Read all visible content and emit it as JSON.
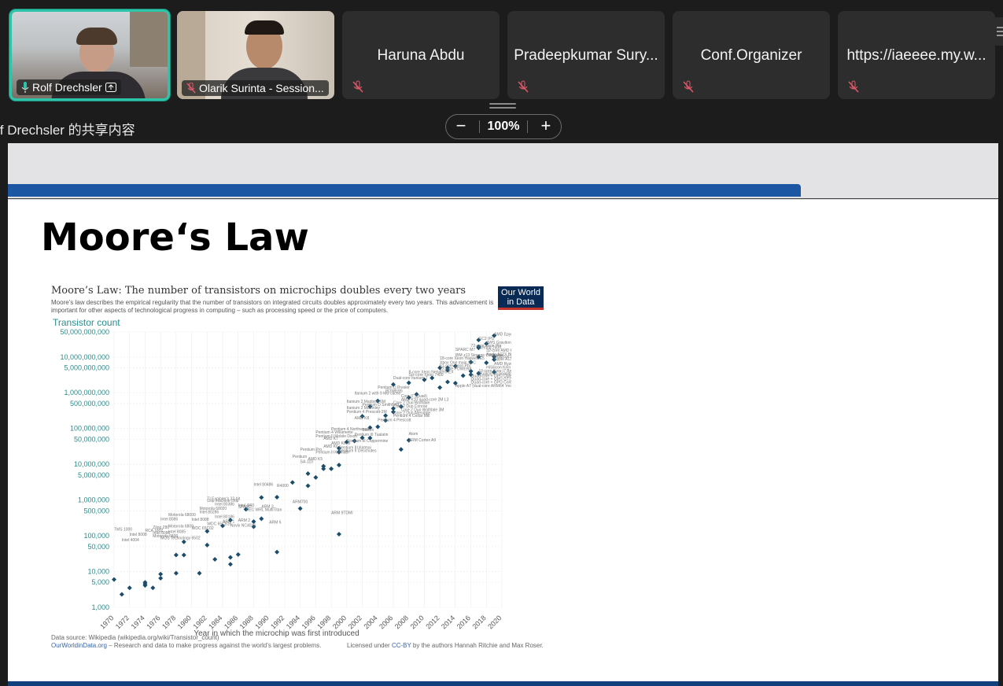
{
  "participants": [
    {
      "name": "Rolf Drechsler",
      "video": true,
      "active": true,
      "mic": "on",
      "presenting": true
    },
    {
      "name": "Olarik Surinta - Session...",
      "video": true,
      "active": false,
      "mic": "muted"
    },
    {
      "name": "Haruna Abdu",
      "video": false,
      "mic": "muted"
    },
    {
      "name": "Pradeepkumar Sury...",
      "video": false,
      "mic": "muted"
    },
    {
      "name": "Conf.Organizer",
      "video": false,
      "mic": "muted"
    },
    {
      "name": "https://iaeeee.my.w...",
      "video": false,
      "mic": "muted"
    }
  ],
  "share": {
    "label": "lf Drechsler 的共享内容",
    "zoom": "100%",
    "zoom_out": "−",
    "zoom_in": "+"
  },
  "slide": {
    "title": "Moore‘s Law"
  },
  "chart_data": {
    "type": "scatter",
    "title": "Moore’s Law: The number of transistors on microchips doubles every two years",
    "subtitle": "Moore’s law describes the empirical regularity that the number of transistors on integrated circuits doubles approximately every two years. This advancement is important for other aspects of technological progress in computing – such as processing speed or the price of computers.",
    "ylabel": "Transistor count",
    "xlabel": "Year in which the microchip was first introduced",
    "yscale": "log",
    "ylim": [
      1000,
      50000000000
    ],
    "xlim": [
      1970,
      2020
    ],
    "yticks": [
      "50,000,000,000",
      "10,000,000,000",
      "5,000,000,000",
      "1,000,000,000",
      "500,000,000",
      "100,000,000",
      "50,000,000",
      "10,000,000",
      "5,000,000",
      "1,000,000",
      "500,000",
      "100,000",
      "50,000",
      "10,000",
      "5,000",
      "1,000"
    ],
    "ytick_values": [
      50000000000,
      10000000000,
      5000000000,
      1000000000,
      500000000,
      100000000,
      50000000,
      10000000,
      5000000,
      1000000,
      500000,
      100000,
      50000,
      10000,
      5000,
      1000
    ],
    "xticks": [
      "1970",
      "1972",
      "1974",
      "1976",
      "1978",
      "1980",
      "1982",
      "1984",
      "1986",
      "1988",
      "1990",
      "1992",
      "1994",
      "1996",
      "1998",
      "2000",
      "2002",
      "2004",
      "2006",
      "2008",
      "2010",
      "2012",
      "2014",
      "2016",
      "2018",
      "2020"
    ],
    "source": "Data source: Wikipedia (wikipedia.org/wiki/Transistor_count)",
    "site": "OurWorldinData.org",
    "site_tail": " – Research and data to make progress against the world’s largest problems.",
    "license_pre": "Licensed under ",
    "license_link": "CC-BY",
    "license_post": " by the authors Hannah Ritchie and Max Roser.",
    "logo_line1": "Our World",
    "logo_line2": "in Data",
    "points": [
      {
        "x": 1971,
        "y": 2300,
        "label": "Intel 4004"
      },
      {
        "x": 1972,
        "y": 3500,
        "label": "Intel 8008"
      },
      {
        "x": 1970,
        "y": 6000,
        "label": "TMS 1000"
      },
      {
        "x": 1974,
        "y": 4500,
        "label": "Intel 8080"
      },
      {
        "x": 1974,
        "y": 5000,
        "label": "RCA 1802"
      },
      {
        "x": 1975,
        "y": 3510,
        "label": "MOS Technology 6502"
      },
      {
        "x": 1974,
        "y": 4100,
        "label": "Motorola 6800"
      },
      {
        "x": 1976,
        "y": 8500,
        "label": "Zilog Z80"
      },
      {
        "x": 1976,
        "y": 6500,
        "label": "Intel 8085"
      },
      {
        "x": 1978,
        "y": 29000,
        "label": "Intel 8086"
      },
      {
        "x": 1979,
        "y": 29000,
        "label": "Intel 8088"
      },
      {
        "x": 1979,
        "y": 68000,
        "label": "Motorola 68000"
      },
      {
        "x": 1978,
        "y": 9000,
        "label": "Motorola 6809"
      },
      {
        "x": 1981,
        "y": 9000,
        "label": "WDC 65C02"
      },
      {
        "x": 1982,
        "y": 55000,
        "label": "Intel 80186"
      },
      {
        "x": 1982,
        "y": 134000,
        "label": "Intel 80286"
      },
      {
        "x": 1983,
        "y": 22000,
        "label": "WDC 65C816"
      },
      {
        "x": 1985,
        "y": 275000,
        "label": "Intel 80386"
      },
      {
        "x": 1985,
        "y": 25000,
        "label": "ARM 1"
      },
      {
        "x": 1986,
        "y": 30000,
        "label": "ARM 2"
      },
      {
        "x": 1984,
        "y": 190000,
        "label": "Motorola 68020"
      },
      {
        "x": 1985,
        "y": 16000,
        "label": "Novix NC4016"
      },
      {
        "x": 1987,
        "y": 553000,
        "label": "TI Explorer's 32-bit Lisp machine chip"
      },
      {
        "x": 1988,
        "y": 250000,
        "label": "Intel i960"
      },
      {
        "x": 1989,
        "y": 1180235,
        "label": "Intel 80486"
      },
      {
        "x": 1988,
        "y": 180000,
        "label": "SPARC"
      },
      {
        "x": 1989,
        "y": 300000,
        "label": "ARM 3"
      },
      {
        "x": 1991,
        "y": 35000,
        "label": "ARM 6"
      },
      {
        "x": 1991,
        "y": 1200000,
        "label": "R4000"
      },
      {
        "x": 1994,
        "y": 578977,
        "label": "ARM700"
      },
      {
        "x": 1993,
        "y": 3100000,
        "label": "Pentium"
      },
      {
        "x": 1995,
        "y": 5500000,
        "label": "Pentium Pro"
      },
      {
        "x": 1995,
        "y": 2500000,
        "label": "SA-110"
      },
      {
        "x": 1996,
        "y": 4300000,
        "label": "AMD K5"
      },
      {
        "x": 1997,
        "y": 7500000,
        "label": "Pentium II Klamath"
      },
      {
        "x": 1998,
        "y": 7500000,
        "label": "Pentium II Deschutes"
      },
      {
        "x": 1997,
        "y": 8800000,
        "label": "AMD K6"
      },
      {
        "x": 1999,
        "y": 9500000,
        "label": "Pentium III Katmai"
      },
      {
        "x": 1999,
        "y": 22000000,
        "label": "AMD K6-III"
      },
      {
        "x": 1999,
        "y": 22000000,
        "label": "AMD K7"
      },
      {
        "x": 1999,
        "y": 28000000,
        "label": "Pentium III Coppermine"
      },
      {
        "x": 1999,
        "y": 111000,
        "label": "ARM 9TDMI"
      },
      {
        "x": 2000,
        "y": 42000000,
        "label": "Pentium 4 Willamette"
      },
      {
        "x": 2001,
        "y": 45000000,
        "label": "Pentium III Tualatin"
      },
      {
        "x": 2002,
        "y": 55000000,
        "label": "Pentium 4 Northwood"
      },
      {
        "x": 2003,
        "y": 54300000,
        "label": "Barton"
      },
      {
        "x": 2003,
        "y": 105900000,
        "label": "AMD K8"
      },
      {
        "x": 2004,
        "y": 112000000,
        "label": "Pentium 4 Prescott"
      },
      {
        "x": 2007,
        "y": 26000000,
        "label": "ARM Cortex A9"
      },
      {
        "x": 2008,
        "y": 47000000,
        "label": "Atom"
      },
      {
        "x": 2006,
        "y": 291000000,
        "label": "Core 2 Duo Conroe"
      },
      {
        "x": 2003,
        "y": 410000000,
        "label": "Itanium 2 Madison 6M"
      },
      {
        "x": 2002,
        "y": 220000000,
        "label": "Itanium 2 McKinley"
      },
      {
        "x": 2005,
        "y": 230000000,
        "label": "Pentium D Smithfield"
      },
      {
        "x": 2006,
        "y": 1700000000,
        "label": "Dual-core Itanium 2"
      },
      {
        "x": 2008,
        "y": 1900000000,
        "label": "Six-core Xeon 7400"
      },
      {
        "x": 2010,
        "y": 2300000000,
        "label": "8-core Xeon Nehalem-EX"
      },
      {
        "x": 2011,
        "y": 2600000000,
        "label": "POWER7"
      },
      {
        "x": 2012,
        "y": 1400000000,
        "label": "Quad-core + GPU Core i7 Ivy Bridge"
      },
      {
        "x": 2014,
        "y": 5560000000,
        "label": "18-core Xeon Haswell-E5"
      },
      {
        "x": 2013,
        "y": 5000000000,
        "label": "Xbox One main SoC"
      },
      {
        "x": 2016,
        "y": 7200000000,
        "label": "72-core Xeon Phi"
      },
      {
        "x": 2017,
        "y": 19200000000,
        "label": "AMD Epyc"
      },
      {
        "x": 2018,
        "y": 23600000000,
        "label": "AWS Graviton2"
      },
      {
        "x": 2019,
        "y": 39540000000,
        "label": "AMD Epyc Rome"
      },
      {
        "x": 2019,
        "y": 8500000000,
        "label": "Apple A13 (iPhone 11 Pro)"
      },
      {
        "x": 2019,
        "y": 3800000000,
        "label": "AMD Ryzen 7 3700X"
      },
      {
        "x": 2018,
        "y": 6900000000,
        "label": "Apple A12X Bionic"
      },
      {
        "x": 2019,
        "y": 10300000000,
        "label": "HiSilicon Kirin 990 5G"
      },
      {
        "x": 2017,
        "y": 19200000000,
        "label": "32-core AMD Epyc"
      },
      {
        "x": 2017,
        "y": 18000000000,
        "label": "Centriq 2400"
      },
      {
        "x": 2017,
        "y": 10000000000,
        "label": "SPARC M7"
      },
      {
        "x": 2017,
        "y": 30000000000,
        "label": "GC2 IPU"
      },
      {
        "x": 2013,
        "y": 2000000000,
        "label": "Apple A7 (dual-core ARM64 'mobile SoC')"
      },
      {
        "x": 2014,
        "y": 1860000000,
        "label": "Quad-core + GPU GT2 Core i7 Skylake K"
      },
      {
        "x": 2016,
        "y": 3200000000,
        "label": "10-core Core i7 Broadwell-E"
      },
      {
        "x": 2016,
        "y": 4000000000,
        "label": "Qualcomm Snapdragon 835"
      },
      {
        "x": 2015,
        "y": 3000000000,
        "label": "IBM z13 Storage Controller"
      },
      {
        "x": 2004,
        "y": 592000000,
        "label": "Itanium 2 with 9 MB cache"
      },
      {
        "x": 2005,
        "y": 169000000,
        "label": "Pentium 4 Cedar Mill"
      },
      {
        "x": 2006,
        "y": 362000000,
        "label": "Core 2 Duo Wolfdale 3M"
      },
      {
        "x": 2007,
        "y": 411000000,
        "label": "Core 2 Duo Allendale"
      },
      {
        "x": 2008,
        "y": 731000000,
        "label": "Core i7 (Quad)"
      },
      {
        "x": 2009,
        "y": 904000000,
        "label": "AMD K10 quad-core 2M L3"
      },
      {
        "x": 2012,
        "y": 5000000000,
        "label": "61-core Xeon Phi"
      },
      {
        "x": 2013,
        "y": 4300000000,
        "label": "12-core POWER8"
      },
      {
        "x": 2017,
        "y": 3500000000,
        "label": "HiSilicon Kirin 710"
      }
    ],
    "annotations": [
      {
        "x": 2017,
        "y": 30000000000,
        "label": "GC2 IPU"
      },
      {
        "x": 2019,
        "y": 39540000000,
        "label": "AMD Epyc Rome"
      },
      {
        "x": 2018,
        "y": 23600000000,
        "label": "AWS Graviton2"
      },
      {
        "x": 2016,
        "y": 19000000000,
        "label": "72-core Xeon Phi"
      },
      {
        "x": 2017,
        "y": 17000000000,
        "label": "Centriq 2400"
      },
      {
        "x": 2014,
        "y": 15000000000,
        "label": "SPARC M7"
      },
      {
        "x": 2018,
        "y": 14000000000,
        "label": "32-core AMD Epyc"
      },
      {
        "x": 2018,
        "y": 11000000000,
        "label": "Apple A12X Bionic"
      },
      {
        "x": 2014,
        "y": 10500000000,
        "label": "IBM z13 Storage Controller"
      },
      {
        "x": 2019,
        "y": 9500000000,
        "label": "HiSilicon Kirin 990 5G"
      },
      {
        "x": 2012,
        "y": 8500000000,
        "label": "18-core Xeon Haswell-E5"
      },
      {
        "x": 2019,
        "y": 8000000000,
        "label": "Apple A13 (iPhone 11 Pro)"
      },
      {
        "x": 2012,
        "y": 6500000000,
        "label": "Xbox One main SoC"
      },
      {
        "x": 2019,
        "y": 6000000000,
        "label": "AMD Ryzen 7 3700X"
      },
      {
        "x": 2012,
        "y": 5200000000,
        "label": "61-core Xeon Phi"
      },
      {
        "x": 2018,
        "y": 4700000000,
        "label": "HiSilicon Kirin 710"
      },
      {
        "x": 2012,
        "y": 4300000000,
        "label": "12-core POWER8"
      },
      {
        "x": 2017,
        "y": 3800000000,
        "label": "10-core Core i7 Broadwell-E"
      },
      {
        "x": 2008,
        "y": 3500000000,
        "label": "8-core Xeon Nehalem-EX"
      },
      {
        "x": 2017,
        "y": 3200000000,
        "label": "Qualcomm Snapdragon 835"
      },
      {
        "x": 2008,
        "y": 2900000000,
        "label": "Six-core Xeon 7400"
      },
      {
        "x": 2016,
        "y": 2700000000,
        "label": "Quad-core + GPU Core i7 Ivy Bridge"
      },
      {
        "x": 2006,
        "y": 2400000000,
        "label": "Dual-core Itanium 2"
      },
      {
        "x": 2016,
        "y": 2200000000,
        "label": "Quad-core + GPU GT2 Core i7 Skylake K"
      },
      {
        "x": 2016,
        "y": 1800000000,
        "label": "Quad-core + GPU Core i7 Haswell"
      },
      {
        "x": 2004,
        "y": 1300000000,
        "label": "Pentium D Presler"
      },
      {
        "x": 2014,
        "y": 1450000000,
        "label": "Apple A7 (dual-core ARM64 'mobile SoC')"
      },
      {
        "x": 2005,
        "y": 1050000000,
        "label": "POWER6"
      },
      {
        "x": 2001,
        "y": 900000000,
        "label": "Itanium 2 with 9 MB cache"
      },
      {
        "x": 2007,
        "y": 750000000,
        "label": "Core i7 (Quad)"
      },
      {
        "x": 2007,
        "y": 600000000,
        "label": "AMD K10 quad-core 2M L3"
      },
      {
        "x": 2000,
        "y": 520000000,
        "label": "Itanium 2 Madison 6M"
      },
      {
        "x": 2006,
        "y": 480000000,
        "label": "Core 2 Duo Wolfdale"
      },
      {
        "x": 2002,
        "y": 430000000,
        "label": "Pentium D Smithfield"
      },
      {
        "x": 2006,
        "y": 390000000,
        "label": "Core 2 Duo Conroe"
      },
      {
        "x": 2000,
        "y": 350000000,
        "label": "Itanium 2 McKinley"
      },
      {
        "x": 2007,
        "y": 310000000,
        "label": "Core 2 Duo Wolfdale 3M"
      },
      {
        "x": 2000,
        "y": 270000000,
        "label": "Pentium 4 Prescott-2M"
      },
      {
        "x": 2006,
        "y": 250000000,
        "label": "Core 2 Duo Allendale"
      },
      {
        "x": 2006,
        "y": 210000000,
        "label": "Pentium 4 Cedar Mill"
      },
      {
        "x": 2001,
        "y": 180000000,
        "label": "AMD K8"
      },
      {
        "x": 2004,
        "y": 160000000,
        "label": "Pentium 4 Prescott"
      },
      {
        "x": 1998,
        "y": 90000000,
        "label": "Pentium 4 Northwood"
      },
      {
        "x": 2002,
        "y": 85000000,
        "label": "Barton"
      },
      {
        "x": 1996,
        "y": 72000000,
        "label": "Pentium 4 Willamette"
      },
      {
        "x": 2008,
        "y": 66000000,
        "label": "Atom"
      },
      {
        "x": 2001,
        "y": 62000000,
        "label": "Pentium III Tualatin"
      },
      {
        "x": 1996,
        "y": 56000000,
        "label": "Pentium II Mobile Dixon"
      },
      {
        "x": 1997,
        "y": 48000000,
        "label": "AMD K7"
      },
      {
        "x": 2008,
        "y": 44000000,
        "label": "ARM Cortex A9"
      },
      {
        "x": 2000,
        "y": 42000000,
        "label": "Pentium III Coppermine"
      },
      {
        "x": 1998,
        "y": 36000000,
        "label": "AMD K6-III"
      },
      {
        "x": 1997,
        "y": 29000000,
        "label": "AMD K6"
      },
      {
        "x": 1999,
        "y": 27000000,
        "label": "Pentium III Katmai"
      },
      {
        "x": 1994,
        "y": 24000000,
        "label": "Pentium Pro"
      },
      {
        "x": 1999,
        "y": 22000000,
        "label": "Pentium II Deschutes"
      },
      {
        "x": 1996,
        "y": 20000000,
        "label": "Pentium II Klamath"
      },
      {
        "x": 1993,
        "y": 15000000,
        "label": "Pentium"
      },
      {
        "x": 1995,
        "y": 13000000,
        "label": "AMD K5"
      },
      {
        "x": 1994,
        "y": 11000000,
        "label": "SA-110"
      },
      {
        "x": 1988,
        "y": 2500000,
        "label": "Intel 80486"
      },
      {
        "x": 1991,
        "y": 2300000,
        "label": "R4000"
      },
      {
        "x": 1982,
        "y": 1000000,
        "label": "TI Explorer's 32-bit"
      },
      {
        "x": 1982,
        "y": 890000,
        "label": "Lisp machine chip"
      },
      {
        "x": 1993,
        "y": 830000,
        "label": "ARM700"
      },
      {
        "x": 1983,
        "y": 700000,
        "label": "Intel 80386"
      },
      {
        "x": 1986,
        "y": 650000,
        "label": "Intel i960"
      },
      {
        "x": 1989,
        "y": 600000,
        "label": "ARM 3"
      },
      {
        "x": 1986,
        "y": 590000,
        "label": "SPARC"
      },
      {
        "x": 1981,
        "y": 540000,
        "label": "Motorola 68020"
      },
      {
        "x": 1987,
        "y": 500000,
        "label": "DEC WRL MultiTitan"
      },
      {
        "x": 1981,
        "y": 420000,
        "label": "Intel 80286"
      },
      {
        "x": 1998,
        "y": 400000,
        "label": "ARM 9TDMI"
      },
      {
        "x": 1977,
        "y": 360000,
        "label": "Motorola 68000"
      },
      {
        "x": 1983,
        "y": 310000,
        "label": "Intel 80186"
      },
      {
        "x": 1976,
        "y": 270000,
        "label": "Intel 8086"
      },
      {
        "x": 1980,
        "y": 260000,
        "label": "Intel 8088"
      },
      {
        "x": 1986,
        "y": 250000,
        "label": "ARM 2"
      },
      {
        "x": 1984,
        "y": 230000,
        "label": "ARM 1"
      },
      {
        "x": 1990,
        "y": 220000,
        "label": "ARM 6"
      },
      {
        "x": 1982,
        "y": 200000,
        "label": "WDC 65C816"
      },
      {
        "x": 1985,
        "y": 180000,
        "label": "Novix NC4016"
      },
      {
        "x": 1977,
        "y": 170000,
        "label": "Motorola 6809"
      },
      {
        "x": 1975,
        "y": 160000,
        "label": "Zilog Z80"
      },
      {
        "x": 1980,
        "y": 150000,
        "label": "WDC 65C02"
      },
      {
        "x": 1970,
        "y": 140000,
        "label": "TMS 1000"
      },
      {
        "x": 1974,
        "y": 130000,
        "label": "RCA 1802"
      },
      {
        "x": 1977,
        "y": 120000,
        "label": "Intel 8085"
      },
      {
        "x": 1975,
        "y": 110000,
        "label": "Intel 8080"
      },
      {
        "x": 1972,
        "y": 100000,
        "label": "Intel 8008"
      },
      {
        "x": 1975,
        "y": 90000,
        "label": "Motorola 6800"
      },
      {
        "x": 1976,
        "y": 80000,
        "label": "MOS Technology 6502"
      },
      {
        "x": 1971,
        "y": 70000,
        "label": "Intel 4004"
      }
    ]
  }
}
